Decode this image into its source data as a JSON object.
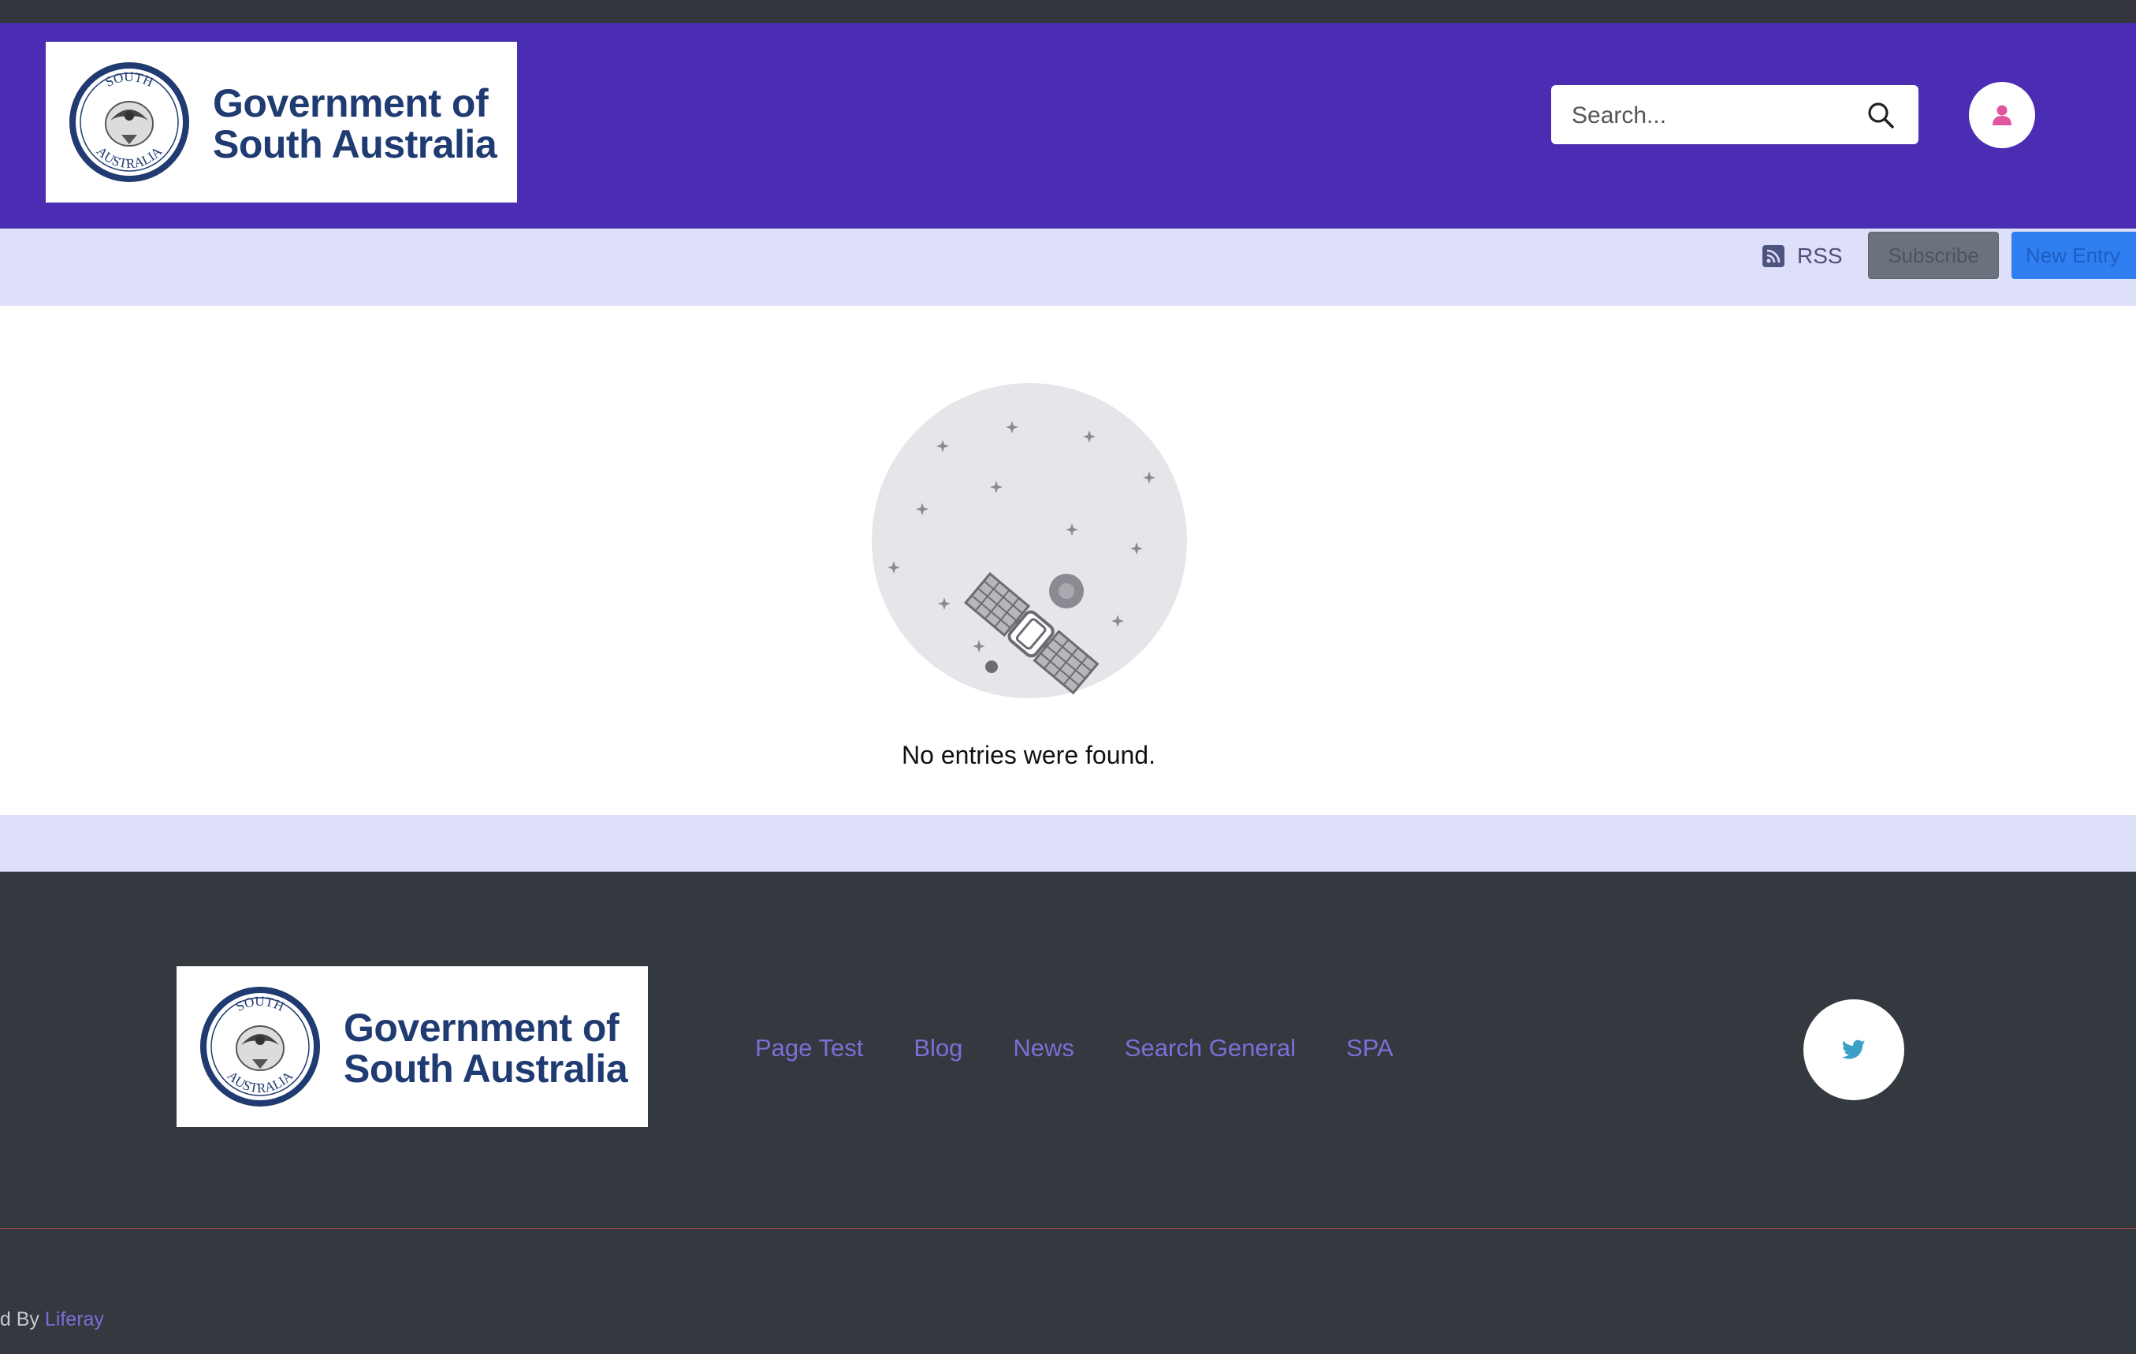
{
  "header": {
    "logo": {
      "line1": "Government of",
      "line2": "South Australia",
      "seal_top": "SOUTH",
      "seal_bottom": "AUSTRALIA"
    },
    "search": {
      "placeholder": "Search..."
    },
    "icons": {
      "search": "search-icon",
      "user": "user-icon"
    },
    "colors": {
      "header_bg": "#4a2db2",
      "user_icon": "#e0559e"
    }
  },
  "toolbar": {
    "rss_label": "RSS",
    "subscribe_label": "Subscribe",
    "new_entry_label": "New Entry"
  },
  "main": {
    "empty_message": "No entries were found.",
    "illustration": "satellite-illustration"
  },
  "footer": {
    "logo": {
      "line1": "Government of",
      "line2": "South Australia",
      "seal_top": "SOUTH",
      "seal_bottom": "AUSTRALIA"
    },
    "nav": [
      "Page Test",
      "Blog",
      "News",
      "Search General",
      "SPA"
    ],
    "social": "twitter-icon",
    "powered_prefix": "ed By",
    "powered_link": "Liferay"
  }
}
